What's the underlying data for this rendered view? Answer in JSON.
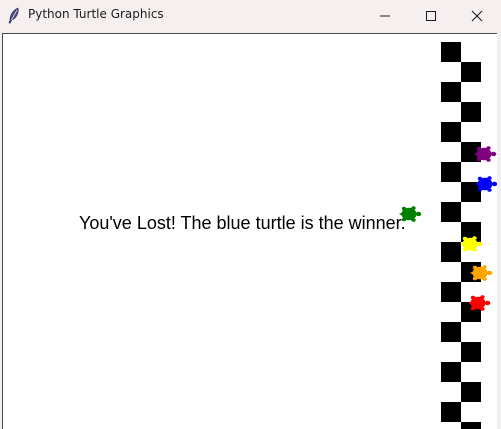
{
  "window": {
    "title": "Python Turtle Graphics",
    "app_icon": "feather-icon",
    "controls": {
      "minimize": "minimize-icon",
      "maximize": "maximize-icon",
      "close": "close-icon"
    }
  },
  "canvas": {
    "message": "You've Lost! The blue turtle is the winner.",
    "turtles": [
      {
        "name": "purple-turtle",
        "color": "#800080"
      },
      {
        "name": "blue-turtle",
        "color": "#0000ff"
      },
      {
        "name": "green-turtle",
        "color": "#008000"
      },
      {
        "name": "yellow-turtle",
        "color": "#ffff00"
      },
      {
        "name": "orange-turtle",
        "color": "#ffa500"
      },
      {
        "name": "red-turtle",
        "color": "#ff0000"
      }
    ],
    "finish_line": {
      "color_a": "#000000",
      "color_b": "#ffffff"
    }
  }
}
